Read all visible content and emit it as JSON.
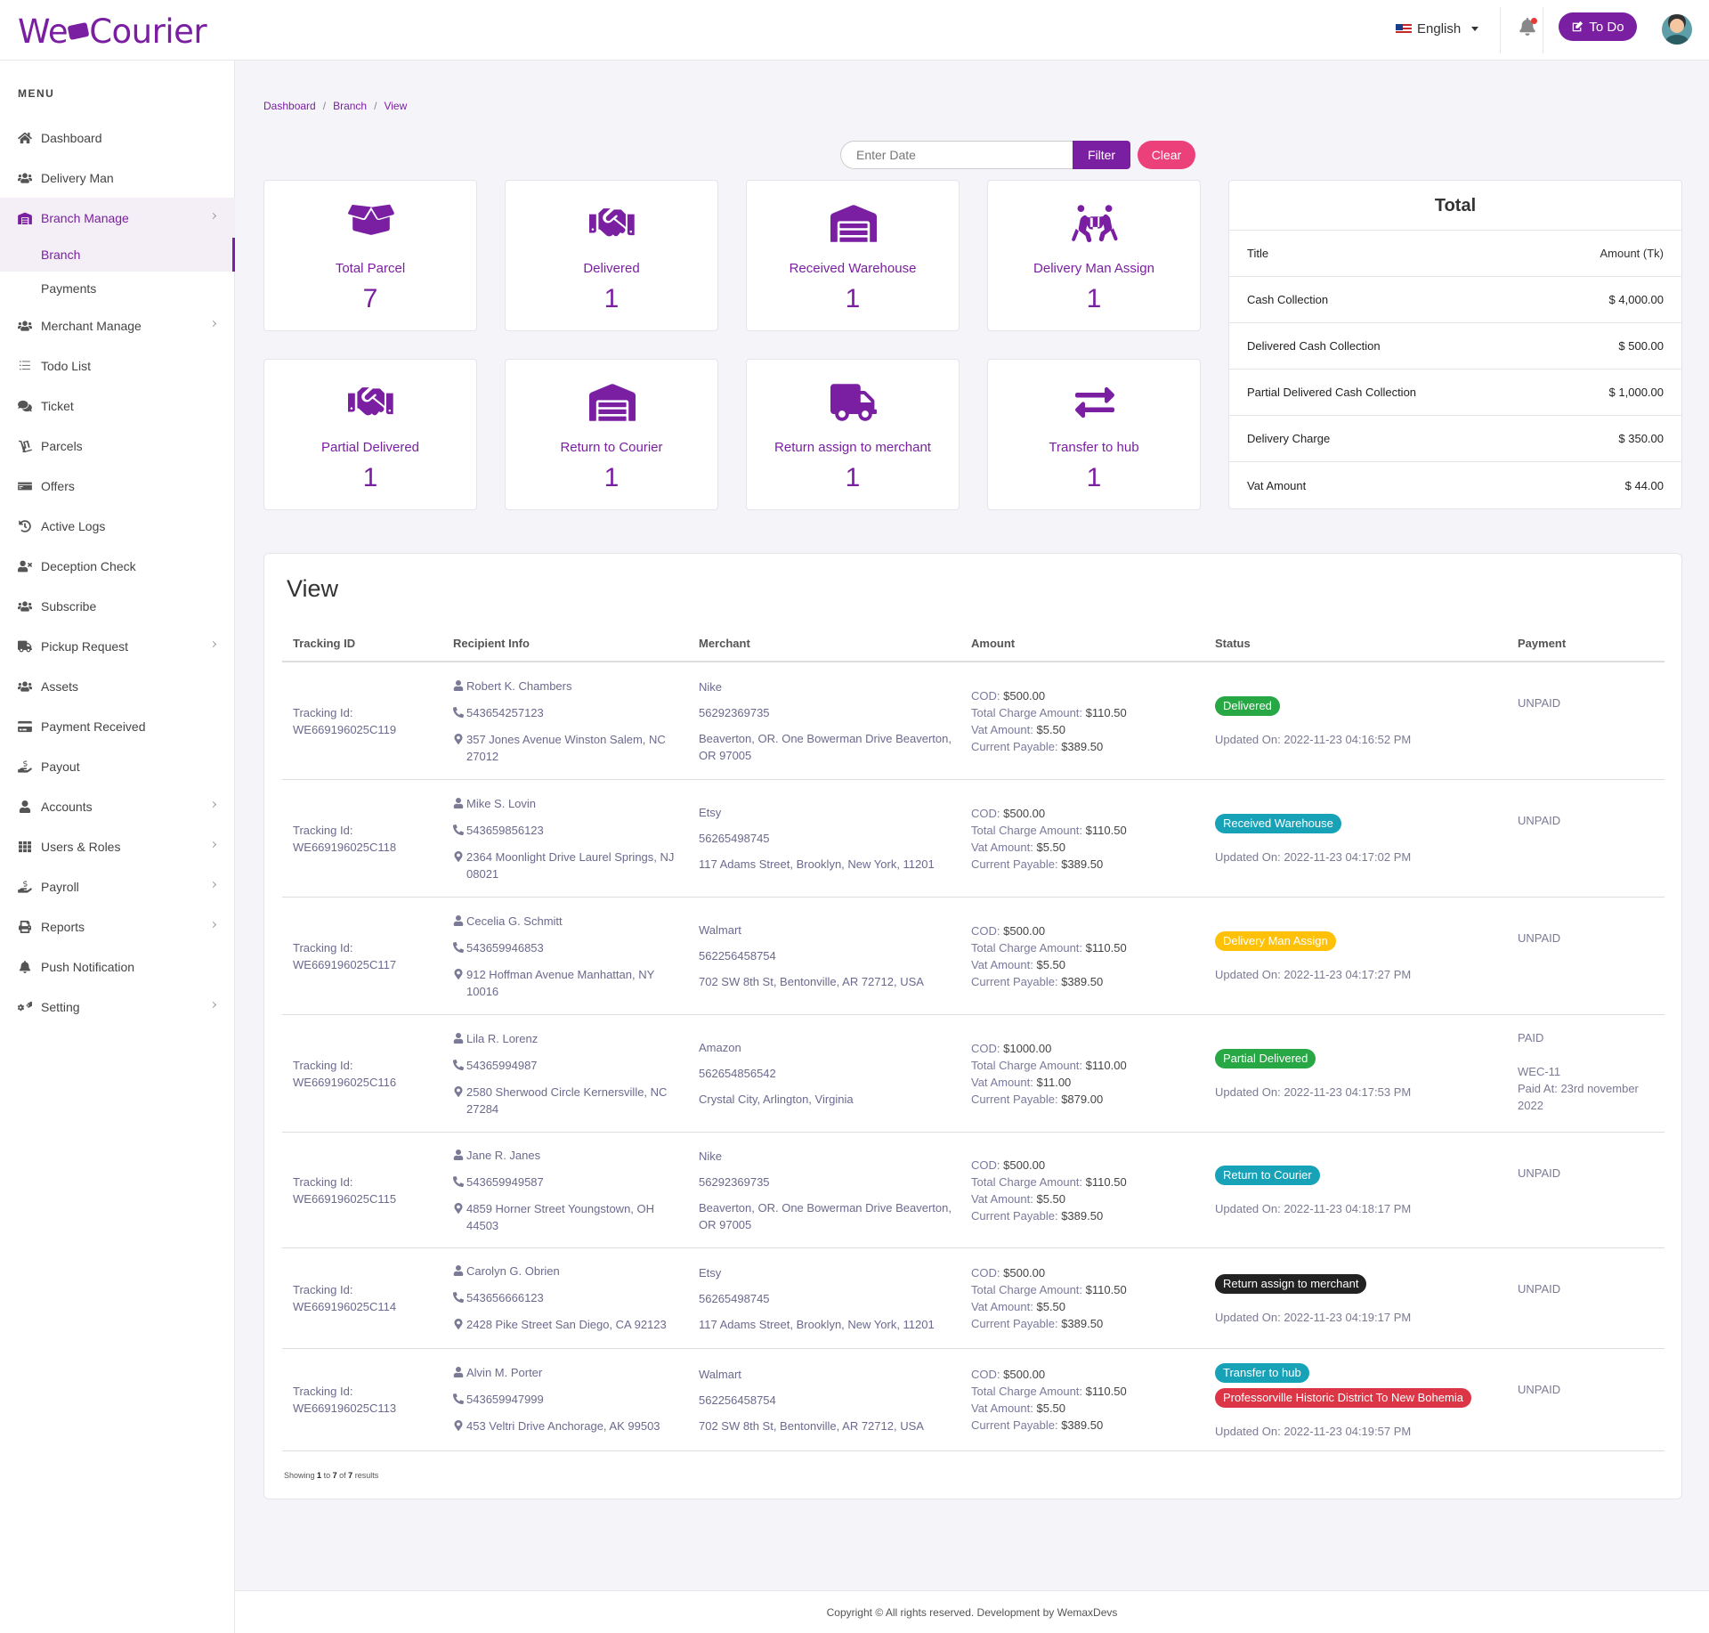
{
  "header": {
    "logo_left": "We",
    "logo_right": "Courier",
    "language": "English",
    "todo_label": "To Do"
  },
  "sidebar": {
    "menu_title": "MENU",
    "items": [
      {
        "label": "Dashboard",
        "icon": "home-icon"
      },
      {
        "label": "Delivery Man",
        "icon": "users-icon"
      },
      {
        "label": "Branch Manage",
        "icon": "building-icon"
      },
      {
        "label": "Merchant Manage",
        "icon": "users-icon"
      },
      {
        "label": "Todo List",
        "icon": "list-icon"
      },
      {
        "label": "Ticket",
        "icon": "comments-icon"
      },
      {
        "label": "Parcels",
        "icon": "dolly-icon"
      },
      {
        "label": "Offers",
        "icon": "offers-icon"
      },
      {
        "label": "Active Logs",
        "icon": "history-icon"
      },
      {
        "label": "Deception Check",
        "icon": "user-x-icon"
      },
      {
        "label": "Subscribe",
        "icon": "users-icon"
      },
      {
        "label": "Pickup Request",
        "icon": "truck-icon"
      },
      {
        "label": "Assets",
        "icon": "users-icon"
      },
      {
        "label": "Payment Received",
        "icon": "credit-card-icon"
      },
      {
        "label": "Payout",
        "icon": "hand-money-icon"
      },
      {
        "label": "Accounts",
        "icon": "user-icon"
      },
      {
        "label": "Users & Roles",
        "icon": "grid-icon"
      },
      {
        "label": "Payroll",
        "icon": "hand-money-icon"
      },
      {
        "label": "Reports",
        "icon": "print-icon"
      },
      {
        "label": "Push Notification",
        "icon": "bell-icon"
      },
      {
        "label": "Setting",
        "icon": "gears-icon"
      }
    ],
    "sub_branch": "Branch",
    "sub_payments": "Payments"
  },
  "breadcrumb": [
    "Dashboard",
    "Branch",
    "View"
  ],
  "breadcrumb_sep": "/",
  "filter": {
    "placeholder": "Enter Date",
    "filter_label": "Filter",
    "clear_label": "Clear"
  },
  "cards": [
    {
      "label": "Total Parcel",
      "value": "7",
      "icon": "box-open-icon"
    },
    {
      "label": "Delivered",
      "value": "1",
      "icon": "handshake-icon"
    },
    {
      "label": "Received Warehouse",
      "value": "1",
      "icon": "warehouse-icon"
    },
    {
      "label": "Delivery Man Assign",
      "value": "1",
      "icon": "people-carry-icon"
    },
    {
      "label": "Partial Delivered",
      "value": "1",
      "icon": "handshake-icon"
    },
    {
      "label": "Return to Courier",
      "value": "1",
      "icon": "warehouse-icon"
    },
    {
      "label": "Return assign to merchant",
      "value": "1",
      "icon": "truck-icon"
    },
    {
      "label": "Transfer to hub",
      "value": "1",
      "icon": "exchange-icon"
    }
  ],
  "total": {
    "title": "Total",
    "head_title": "Title",
    "head_amount": "Amount (Tk)",
    "rows": [
      {
        "title": "Cash Collection",
        "amount": "$ 4,000.00"
      },
      {
        "title": "Delivered Cash Collection",
        "amount": "$ 500.00"
      },
      {
        "title": "Partial Delivered Cash Collection",
        "amount": "$ 1,000.00"
      },
      {
        "title": "Delivery Charge",
        "amount": "$ 350.00"
      },
      {
        "title": "Vat Amount",
        "amount": "$ 44.00"
      }
    ]
  },
  "view": {
    "title": "View",
    "columns": [
      "Tracking ID",
      "Recipient Info",
      "Merchant",
      "Amount",
      "Status",
      "Payment"
    ],
    "labels": {
      "tracking": "Tracking Id:",
      "cod": "COD:",
      "total_charge": "Total Charge Amount:",
      "vat": "Vat Amount:",
      "current_payable": "Current Payable:",
      "updated_on": "Updated On:",
      "paid_at": "Paid At:"
    },
    "rows": [
      {
        "tracking": "WE669196025C119",
        "name": "Robert K. Chambers",
        "phone": "543654257123",
        "address": "357 Jones Avenue Winston Salem, NC 27012",
        "merchant": "Nike",
        "merchant_phone": "56292369735",
        "merchant_address": "Beaverton, OR. One Bowerman Drive Beaverton, OR 97005",
        "cod": "$500.00",
        "total_charge": "$110.50",
        "vat": "$5.50",
        "payable": "$389.50",
        "status": "Delivered",
        "status_color": "#28a745",
        "updated": "2022-11-23 04:16:52 PM",
        "payment": "UNPAID"
      },
      {
        "tracking": "WE669196025C118",
        "name": "Mike S. Lovin",
        "phone": "543659856123",
        "address": "2364 Moonlight Drive Laurel Springs, NJ 08021",
        "merchant": "Etsy",
        "merchant_phone": "56265498745",
        "merchant_address": "117 Adams Street, Brooklyn, New York, 11201",
        "cod": "$500.00",
        "total_charge": "$110.50",
        "vat": "$5.50",
        "payable": "$389.50",
        "status": "Received Warehouse",
        "status_color": "#17a2b8",
        "updated": "2022-11-23 04:17:02 PM",
        "payment": "UNPAID"
      },
      {
        "tracking": "WE669196025C117",
        "name": "Cecelia G. Schmitt",
        "phone": "543659946853",
        "address": "912 Hoffman Avenue Manhattan, NY 10016",
        "merchant": "Walmart",
        "merchant_phone": "562256458754",
        "merchant_address": "702 SW 8th St, Bentonville, AR 72712, USA",
        "cod": "$500.00",
        "total_charge": "$110.50",
        "vat": "$5.50",
        "payable": "$389.50",
        "status": "Delivery Man Assign",
        "status_color": "#ffc107",
        "updated": "2022-11-23 04:17:27 PM",
        "payment": "UNPAID"
      },
      {
        "tracking": "WE669196025C116",
        "name": "Lila R. Lorenz",
        "phone": "54365994987",
        "address": "2580 Sherwood Circle Kernersville, NC 27284",
        "merchant": "Amazon",
        "merchant_phone": "562654856542",
        "merchant_address": "Crystal City, Arlington, Virginia",
        "cod": "$1000.00",
        "total_charge": "$110.00",
        "vat": "$11.00",
        "payable": "$879.00",
        "status": "Partial Delivered",
        "status_color": "#28a745",
        "updated": "2022-11-23 04:17:53 PM",
        "payment": "PAID",
        "payment_ref": "WEC-11",
        "paid_at": "23rd november 2022"
      },
      {
        "tracking": "WE669196025C115",
        "name": "Jane R. Janes",
        "phone": "543659949587",
        "address": "4859 Horner Street Youngstown, OH 44503",
        "merchant": "Nike",
        "merchant_phone": "56292369735",
        "merchant_address": "Beaverton, OR. One Bowerman Drive Beaverton, OR 97005",
        "cod": "$500.00",
        "total_charge": "$110.50",
        "vat": "$5.50",
        "payable": "$389.50",
        "status": "Return to Courier",
        "status_color": "#17a2b8",
        "updated": "2022-11-23 04:18:17 PM",
        "payment": "UNPAID"
      },
      {
        "tracking": "WE669196025C114",
        "name": "Carolyn G. Obrien",
        "phone": "543656666123",
        "address": "2428 Pike Street San Diego, CA 92123",
        "merchant": "Etsy",
        "merchant_phone": "56265498745",
        "merchant_address": "117 Adams Street, Brooklyn, New York, 11201",
        "cod": "$500.00",
        "total_charge": "$110.50",
        "vat": "$5.50",
        "payable": "$389.50",
        "status": "Return assign to merchant",
        "status_color": "#222222",
        "updated": "2022-11-23 04:19:17 PM",
        "payment": "UNPAID"
      },
      {
        "tracking": "WE669196025C113",
        "name": "Alvin M. Porter",
        "phone": "543659947999",
        "address": "453 Veltri Drive Anchorage, AK 99503",
        "merchant": "Walmart",
        "merchant_phone": "562256458754",
        "merchant_address": "702 SW 8th St, Bentonville, AR 72712, USA",
        "cod": "$500.00",
        "total_charge": "$110.50",
        "vat": "$5.50",
        "payable": "$389.50",
        "status": "Transfer to hub",
        "status_color": "#17a2b8",
        "status2": "Professorville Historic District To New Bohemia",
        "status2_color": "#dc3545",
        "updated": "2022-11-23 04:19:57 PM",
        "payment": "UNPAID"
      }
    ],
    "showing_pre": "Showing",
    "showing_from": "1",
    "showing_to_word": "to",
    "showing_to": "7",
    "showing_of_word": "of",
    "showing_total": "7",
    "showing_post": "results"
  },
  "footer": "Copyright © All rights reserved. Development by WemaxDevs"
}
